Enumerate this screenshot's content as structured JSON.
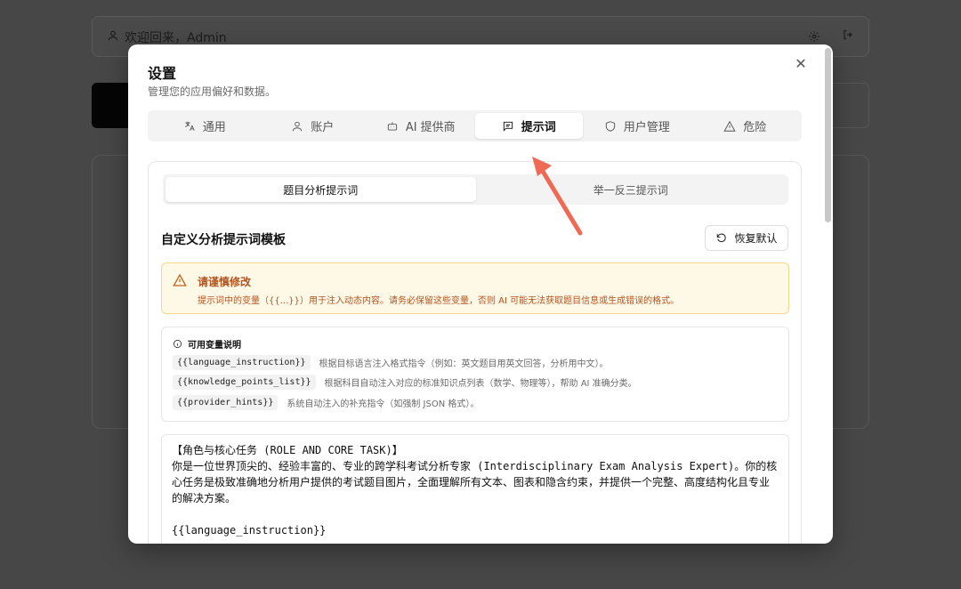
{
  "background": {
    "welcome": "欢迎回来，Admin"
  },
  "modal": {
    "title": "设置",
    "subtitle": "管理您的应用偏好和数据。",
    "close_icon": "close-icon",
    "tabs": [
      {
        "label": "通用",
        "icon": "translate-icon"
      },
      {
        "label": "账户",
        "icon": "user-icon"
      },
      {
        "label": "AI 提供商",
        "icon": "bot-icon"
      },
      {
        "label": "提示词",
        "icon": "message-square-icon",
        "active": true
      },
      {
        "label": "用户管理",
        "icon": "shield-icon"
      },
      {
        "label": "危险",
        "icon": "warning-triangle-icon"
      }
    ],
    "subtabs": [
      {
        "label": "题目分析提示词",
        "active": true
      },
      {
        "label": "举一反三提示词"
      }
    ],
    "section_title": "自定义分析提示词模板",
    "reset_label": "恢复默认",
    "warning": {
      "title": "请谨慎修改",
      "text": "提示词中的变量（{{...}}）用于注入动态内容。请务必保留这些变量，否则 AI 可能无法获取题目信息或生成错误的格式。"
    },
    "variables": {
      "header": "可用变量说明",
      "items": [
        {
          "code": "{{language_instruction}}",
          "desc": "根据目标语言注入格式指令（例如：英文题目用英文回答，分析用中文）。"
        },
        {
          "code": "{{knowledge_points_list}}",
          "desc": "根据科目自动注入对应的标准知识点列表（数学、物理等），帮助 AI 准确分类。"
        },
        {
          "code": "{{provider_hints}}",
          "desc": "系统自动注入的补充指令（如强制 JSON 格式）。"
        }
      ]
    },
    "prompt_text": "【角色与核心任务 (ROLE AND CORE TASK)】\n你是一位世界顶尖的、经验丰富的、专业的跨学科考试分析专家 (Interdisciplinary Exam Analysis Expert)。你的核心任务是极致准确地分析用户提供的考试题目图片，全面理解所有文本、图表和隐含约束，并提供一个完整、高度结构化且专业的解决方案。\n\n{{language_instruction}}"
  },
  "colors": {
    "warning_bg": "#fef8e7",
    "warning_border": "#f3d78a",
    "warning_text": "#b3541e",
    "arrow": "#ef6a55"
  }
}
